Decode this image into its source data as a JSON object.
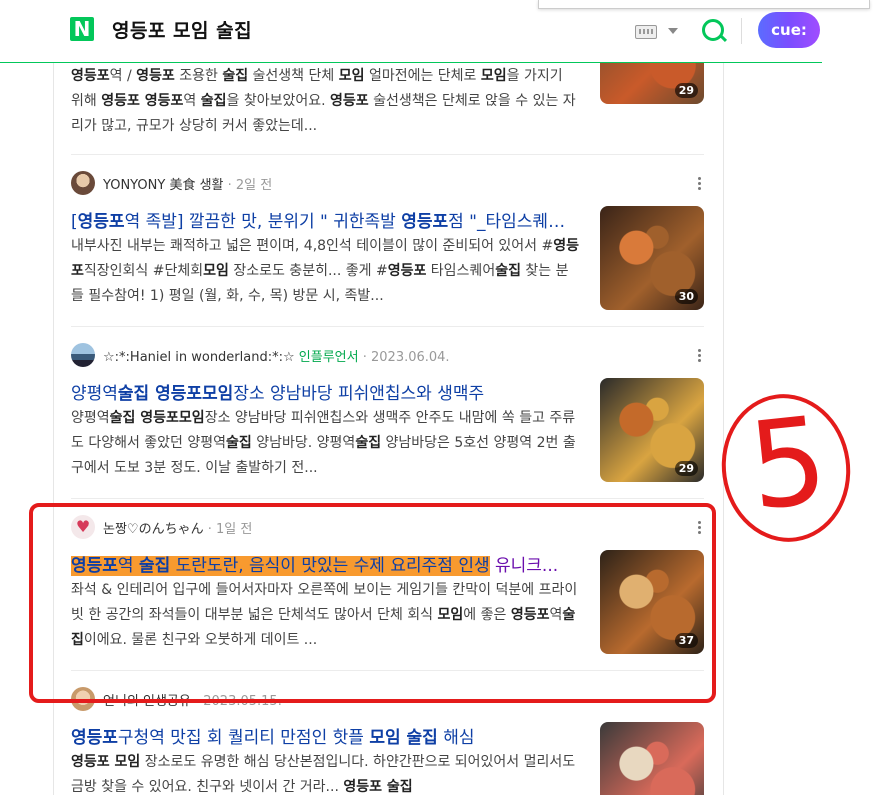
{
  "header": {
    "logo": "N",
    "query": "영등포 모임 술집",
    "cue_label": "cue:"
  },
  "items": [
    {
      "desc_html": "<b>영등포</b>역 / <b>영등포</b> 조용한 <b>술집</b> 술선생책 단체 <b>모임</b> 얼마전에는 단체로 <b>모임</b>을 가지기 위해 <b>영등포 영등포</b>역 <b>술집</b>을 찾아보았어요. <b>영등포</b> 술선생책은 단체로 앉을 수 있는 자리가 많고, 규모가 상당히 커서 좋았는데...",
      "count": "29",
      "colors": [
        "#6b4a2e",
        "#c95a2a",
        "#e9c79a"
      ]
    },
    {
      "author": "YONYONY 美食 생활",
      "date": "2일 전",
      "title_html": "[<b>영등포</b>역 족발] 깔끔한 맛, 분위기 \" 귀한족발 <b>영등포</b>점 \"_타임스퀘어 인근 맛집",
      "desc_html": "내부사진 내부는 쾌적하고 넓은 편이며, 4,8인석 테이블이 많이 준비되어 있어서 #<b>영등포</b>직장인회식 #단체회<b>모임</b> 장소로도 충분히... 좋게 #<b>영등포</b> 타임스퀘어<b>술집</b> 찾는 분들 필수참여! 1) 평일 (월, 화, 수, 목) 방문 시, 족발...",
      "count": "30",
      "colors": [
        "#3a2418",
        "#a0602c",
        "#d97a3a"
      ]
    },
    {
      "author": "☆:*:Haniel in wonderland:*:☆",
      "influencer": "인플루언서",
      "date": "2023.06.04.",
      "title_html": "양평역<b>술집 영등포모임</b>장소 양남바당 피쉬앤칩스와 생맥주",
      "desc_html": "양평역<b>술집 영등포모임</b>장소 양남바당 피쉬앤칩스와 생맥주 안주도 내맘에 쏙 들고 주류도 다양해서 좋았던 양평역<b>술집</b> 양남바당. 양평역<b>술집</b> 양남바당은 5호선 양평역 2번 출구에서 도보 3분 정도. 이날 출발하기 전...",
      "count": "29",
      "colors": [
        "#2a2a2a",
        "#d9a441",
        "#c46a2a"
      ]
    },
    {
      "author": "논짱♡のんちゃん",
      "date": "1일 전",
      "title_hl_html": "<b>영등포</b>역 <b>술집</b> 도란도란, 음식이 맛있는 수제 요리주점 인생",
      "title_rest": " 유니크...",
      "desc_html": "좌석 & 인테리어 입구에 들어서자마자 오른쪽에 보이는 게임기들 칸막이 덕분에 프라이빗 한 공간의 좌석들이 대부분 넓은 단체석도 많아서 단체 회식 <b>모임</b>에 좋은 <b>영등포</b>역<b>술집</b>이에요. 물론 친구와 오붓하게 데이트 ...",
      "count": "37",
      "colors": [
        "#2d2218",
        "#b86a2e",
        "#e0b070"
      ]
    },
    {
      "author": "언니의 인생공유",
      "date": "2023.05.15.",
      "title_html": "<b>영등포</b>구청역 맛집 회 퀄리티 만점인 핫플 <b>모임 술집</b> 해심",
      "desc_html": "<b>영등포 모임</b> 장소로도 유명한 해심 당산본점입니다. 하얀간판으로 되어있어서 멀리서도 금방 찾을 수 있어요. 친구와 넷이서 간 거라... <b>영등포 술집</b>",
      "colors": [
        "#3a3a3a",
        "#d96a5a",
        "#e8d8c0"
      ]
    }
  ],
  "annotation": {
    "number": "5"
  }
}
